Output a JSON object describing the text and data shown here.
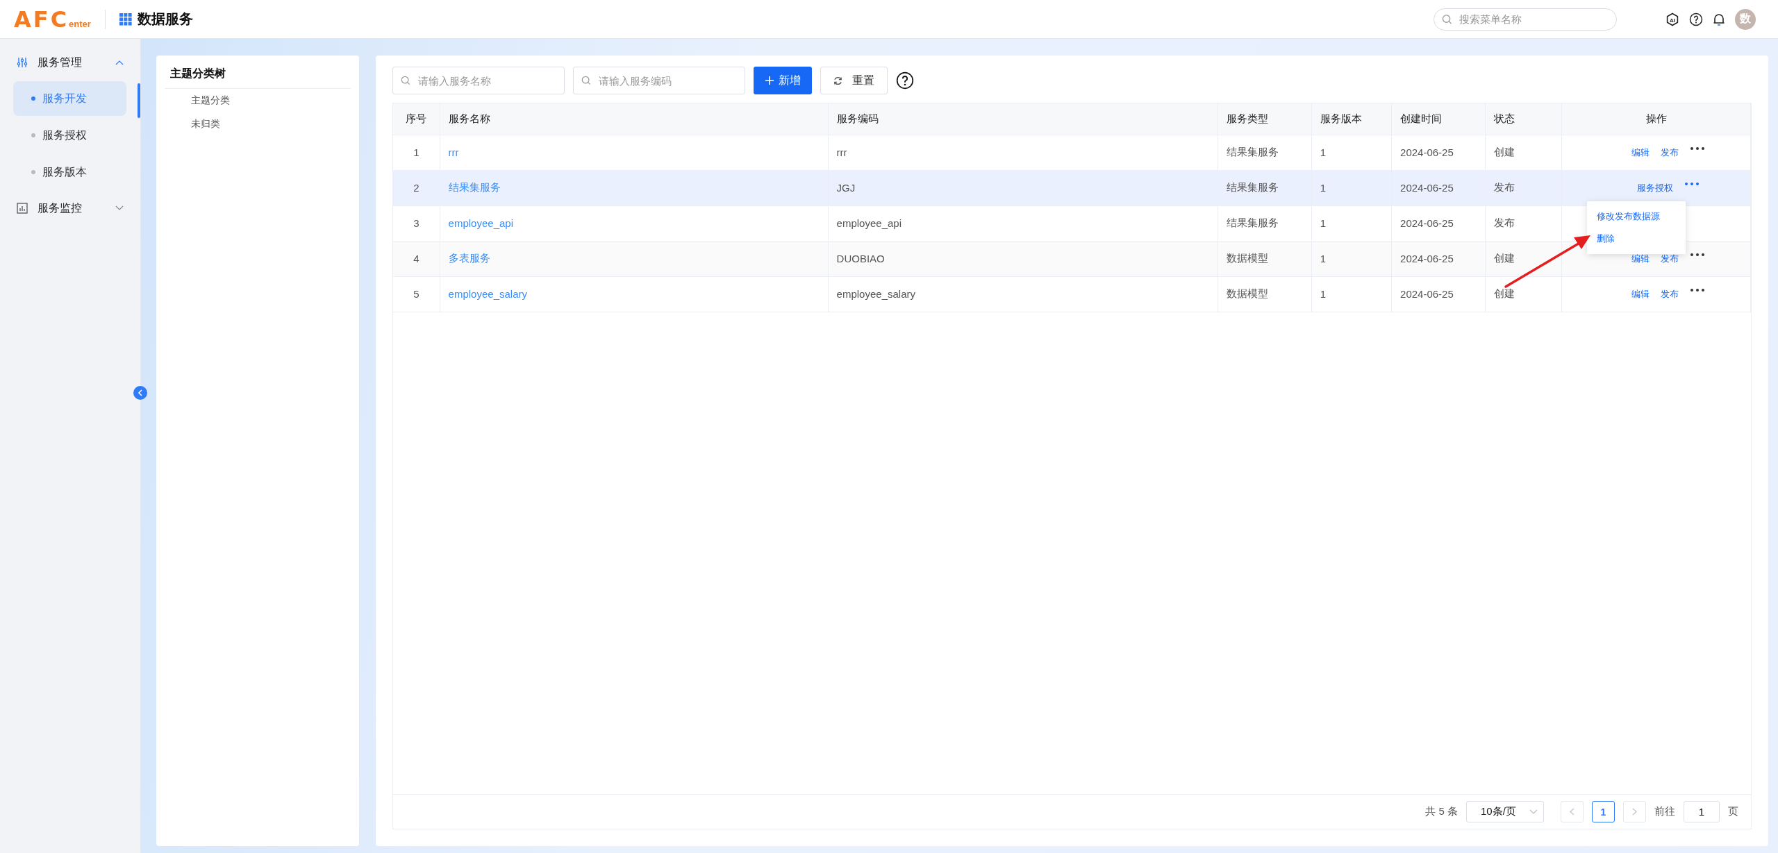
{
  "header": {
    "logo": {
      "big": "AFC",
      "small": "enter"
    },
    "app_title": "数据服务",
    "search": {
      "placeholder": "搜索菜单名称"
    },
    "ai_label": "AI",
    "avatar": "数"
  },
  "sidebar": {
    "groups": [
      {
        "label": "服务管理",
        "expanded": true,
        "items": [
          {
            "label": "服务开发",
            "selected": true
          },
          {
            "label": "服务授权",
            "selected": false
          },
          {
            "label": "服务版本",
            "selected": false
          }
        ]
      },
      {
        "label": "服务监控",
        "expanded": false
      }
    ]
  },
  "tree": {
    "title": "主题分类树",
    "nodes": [
      {
        "label": "主题分类"
      },
      {
        "label": "未归类"
      }
    ]
  },
  "toolbar": {
    "name_search": {
      "placeholder": "请输入服务名称"
    },
    "code_search": {
      "placeholder": "请输入服务编码"
    },
    "add_button": "新增",
    "reset_button": "重置"
  },
  "table": {
    "columns": [
      "序号",
      "服务名称",
      "服务编码",
      "服务类型",
      "服务版本",
      "创建时间",
      "状态",
      "操作"
    ],
    "rows": [
      {
        "index": "1",
        "name": "rrr",
        "code": "rrr",
        "type": "结果集服务",
        "version": "1",
        "created": "2024-06-25",
        "status": "创建",
        "highlighted": false,
        "actions": [
          "编辑",
          "发布"
        ],
        "menu_open": false
      },
      {
        "index": "2",
        "name": "结果集服务",
        "code": "JGJ",
        "type": "结果集服务",
        "version": "1",
        "created": "2024-06-25",
        "status": "发布",
        "highlighted": true,
        "actions": [
          "服务授权"
        ],
        "menu_open": true
      },
      {
        "index": "3",
        "name": "employee_api",
        "code": "employee_api",
        "type": "结果集服务",
        "version": "1",
        "created": "2024-06-25",
        "status": "发布",
        "highlighted": false,
        "actions": [],
        "menu_open": false
      },
      {
        "index": "4",
        "name": "多表服务",
        "code": "DUOBIAO",
        "type": "数据模型",
        "version": "1",
        "created": "2024-06-25",
        "status": "创建",
        "highlighted": false,
        "actions": [
          "编辑",
          "发布"
        ],
        "menu_open": false
      },
      {
        "index": "5",
        "name": "employee_salary",
        "code": "employee_salary",
        "type": "数据模型",
        "version": "1",
        "created": "2024-06-25",
        "status": "创建",
        "highlighted": false,
        "actions": [
          "编辑",
          "发布"
        ],
        "menu_open": false
      }
    ],
    "menu": [
      "修改发布数据源",
      "删除"
    ]
  },
  "pagination": {
    "total": "共 5 条",
    "page_size": "10条/页",
    "pages": [
      {
        "label": "1",
        "selected": true
      }
    ],
    "goto_label": "前往",
    "goto_value": "1",
    "page_unit": "页"
  }
}
